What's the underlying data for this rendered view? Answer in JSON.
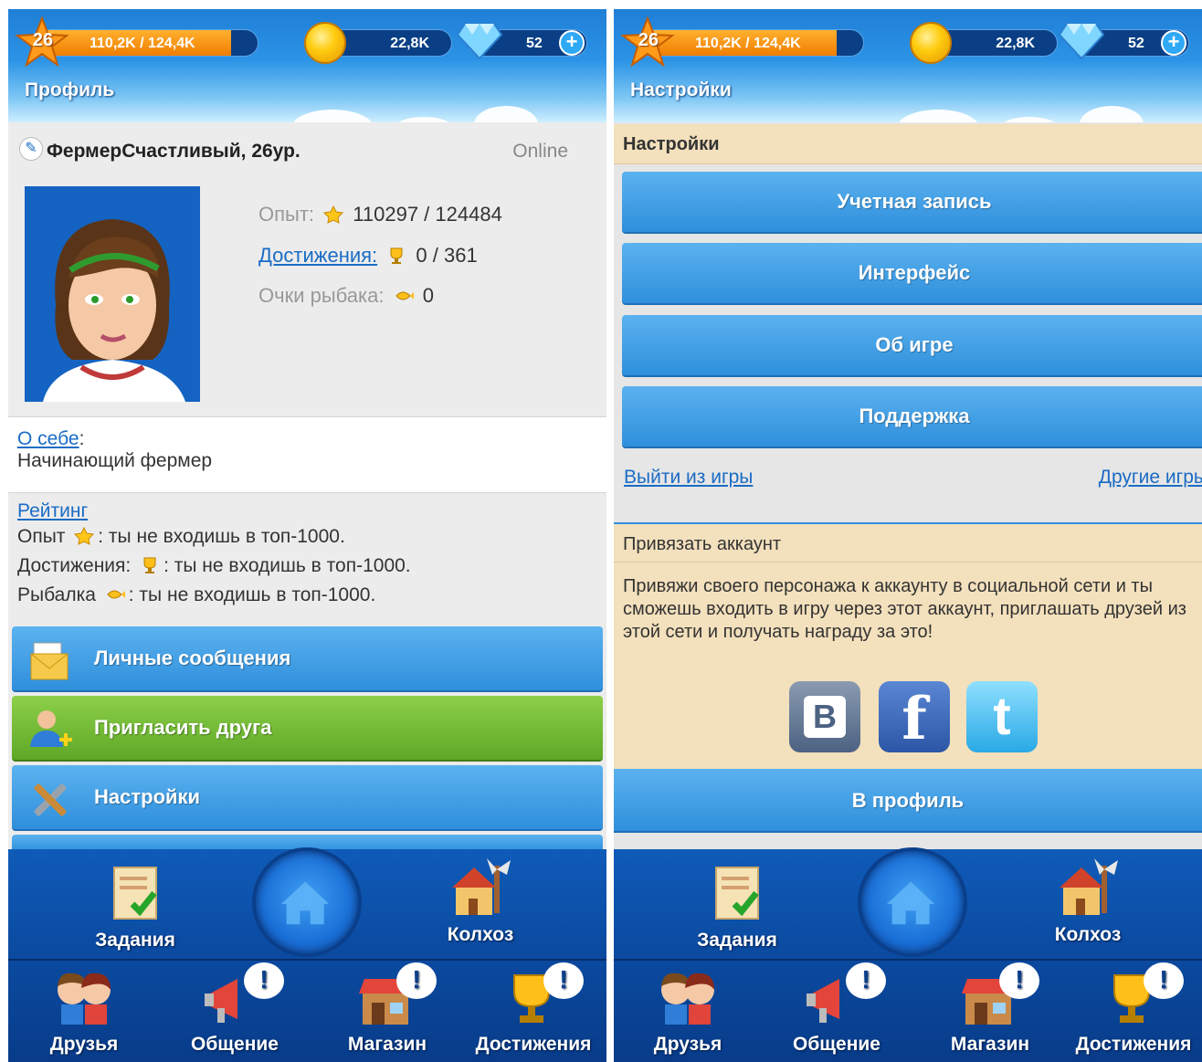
{
  "colors": {
    "header_blue": "#2b93e6",
    "button_blue": "#2f8fdc",
    "button_green": "#5ea826",
    "nav_blue": "#0b4aa0",
    "link": "#1a6cc5",
    "section_beige": "#f3e0bc",
    "xp_orange": "#f07d00"
  },
  "topbar": {
    "level": "26",
    "xp": "110,2K / 124,4K",
    "xp_fraction": 0.885,
    "coins": "22,8K",
    "gems": "52",
    "plus": "+"
  },
  "profile": {
    "title": "Профиль",
    "edit_icon": "pencil-icon",
    "nickname": "ФермерСчастливый, 26ур.",
    "status": "Online",
    "exp_label": "Опыт:",
    "exp_value": "110297 / 124484",
    "achievements_label": "Достижения:",
    "achievements_value": "0 / 361",
    "fisher_label": "Очки рыбака:",
    "fisher_value": "0",
    "about_label": "О себе",
    "about_colon": ":",
    "about_text": "Начинающий фермер",
    "rating_label": "Рейтинг",
    "rating_rows": [
      {
        "name": "Опыт",
        "icon": "star-icon",
        "text": ": ты не входишь в топ-1000."
      },
      {
        "name": "Достижения:",
        "icon": "trophy-icon",
        "text": ": ты не входишь в топ-1000."
      },
      {
        "name": "Рыбалка",
        "icon": "fish-icon",
        "text": ": ты не входишь в топ-1000."
      }
    ],
    "menu": [
      {
        "label": "Личные сообщения",
        "icon": "envelope-icon"
      },
      {
        "label": "Пригласить друга",
        "icon": "add-friend-icon"
      },
      {
        "label": "Настройки",
        "icon": "tools-icon"
      }
    ]
  },
  "settings": {
    "title": "Настройки",
    "section_title": "Настройки",
    "buttons": [
      "Учетная запись",
      "Интерфейс",
      "Об игре",
      "Поддержка"
    ],
    "logout_link": "Выйти из игры",
    "other_games_link": "Другие игры",
    "bind_title": "Привязать аккаунт",
    "bind_text": "Привяжи своего персонажа к аккаунту в социальной сети и ты сможешь входить в игру через этот аккаунт, приглашать друзей из этой сети и получать награду за это!",
    "social": [
      {
        "name": "vk-icon",
        "glyph": "B"
      },
      {
        "name": "facebook-icon",
        "glyph": "f"
      },
      {
        "name": "twitter-icon",
        "glyph": "t"
      }
    ],
    "to_profile": "В профиль"
  },
  "nav": {
    "tasks": "Задания",
    "kolkhoz": "Колхоз",
    "friends": "Друзья",
    "chat": "Общение",
    "shop": "Магазин",
    "achievements": "Достижения",
    "alert_glyph": "!"
  }
}
